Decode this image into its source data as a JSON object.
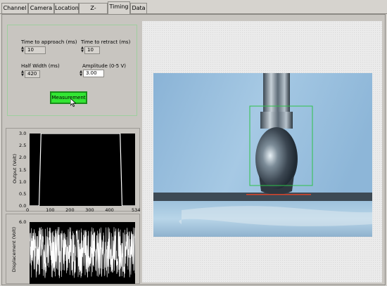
{
  "tabs": [
    {
      "label": "Channel",
      "active": false
    },
    {
      "label": "Camera",
      "active": false
    },
    {
      "label": "Location",
      "active": false
    },
    {
      "label": "Z-Position",
      "active": false
    },
    {
      "label": "Timing",
      "active": true
    },
    {
      "label": "Data",
      "active": false
    }
  ],
  "timing": {
    "approach_label": "Time to approach (ms)",
    "approach_value": "10",
    "retract_label": "Time to retract (ms)",
    "retract_value": "10",
    "halfwidth_label": "Half Width (ms)",
    "halfwidth_value": "420",
    "amplitude_label": "Amplitude (0-5 V)",
    "amplitude_value": "3.00",
    "measurement_label": "Measurement"
  },
  "colors": {
    "button_green": "#33e633",
    "panel_border": "#9ecf9e",
    "roi_box": "#2ec24a",
    "contact_line": "#d9442a"
  },
  "chart_data": [
    {
      "type": "line",
      "ylabel": "Output (Volt)",
      "xlim": [
        0,
        534
      ],
      "ylim": [
        0,
        3.0
      ],
      "x_ticks": [
        "0",
        "100",
        "200",
        "300",
        "400",
        "534"
      ],
      "y_ticks": [
        "0.0",
        "0.5",
        "1.0",
        "1.5",
        "2.0",
        "2.5",
        "3.0"
      ],
      "series": [
        {
          "x": [
            0,
            48,
            58,
            458,
            468,
            534
          ],
          "y": [
            0,
            0,
            3.0,
            3.0,
            0,
            0
          ]
        }
      ]
    },
    {
      "type": "line",
      "ylabel": "Displacement (Volt)",
      "y_ticks": [
        "6.0"
      ]
    }
  ]
}
